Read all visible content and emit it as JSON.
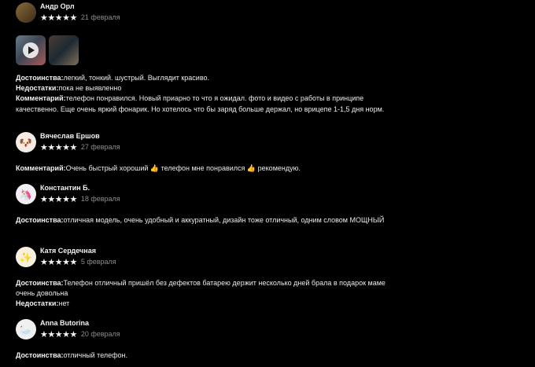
{
  "reviews": [
    {
      "author": "Андр Орл",
      "stars": "★★★★★",
      "date": "21 февраля",
      "avatar_icon": "profile-photo",
      "has_media": true,
      "pros_label": "Достоинства:",
      "pros": "легкий, тонкий. шустрый. Выглядит красиво.",
      "cons_label": "Недостатки:",
      "cons": "пока не выявленно",
      "comment_label": "Комментарий:",
      "comment": "телефон понравился. Новый приарно то что я ожидал. фото и видео с работы в принципе качественно. Еще очень яркий фонарик. Но хотелось что бы заряд больше держал, но врицепе 1-1,5 дня норм."
    },
    {
      "author": "Вячеслав Ершов",
      "stars": "★★★★★",
      "date": "27 февраля",
      "avatar_icon": "dog-avatar",
      "comment_label": "Комментарий:",
      "comment": "Очень быстрый хороший 👍 телефон мне понравился 👍 рекомендую."
    },
    {
      "author": "Константин Б.",
      "stars": "★★★★★",
      "date": "18 февраля",
      "avatar_icon": "unicorn-avatar",
      "pros_label": "Достоинства:",
      "pros": "отличная модель, очень удобный и аккуратный, дизайн тоже отличный, одним словом МОЩНЫЙ"
    },
    {
      "author": "Катя Сердечная",
      "stars": "★★★★★",
      "date": "5 февраля",
      "avatar_icon": "sparkle-avatar",
      "pros_label": "Достоинства:",
      "pros": "Телефон отличный пришёл без дефектов батарею держит несколько дней брала в подарок маме очень довольна",
      "cons_label": "Недостатки:",
      "cons": "нет"
    },
    {
      "author": "Anna Butorina",
      "stars": "★★★★★",
      "date": "20 февраля",
      "avatar_icon": "goose-avatar",
      "pros_label": "Достоинства:",
      "pros": "отличный телефон."
    }
  ],
  "colors": {
    "background": "#000000",
    "text": "#eaeaea",
    "date": "#8c8c8c"
  }
}
